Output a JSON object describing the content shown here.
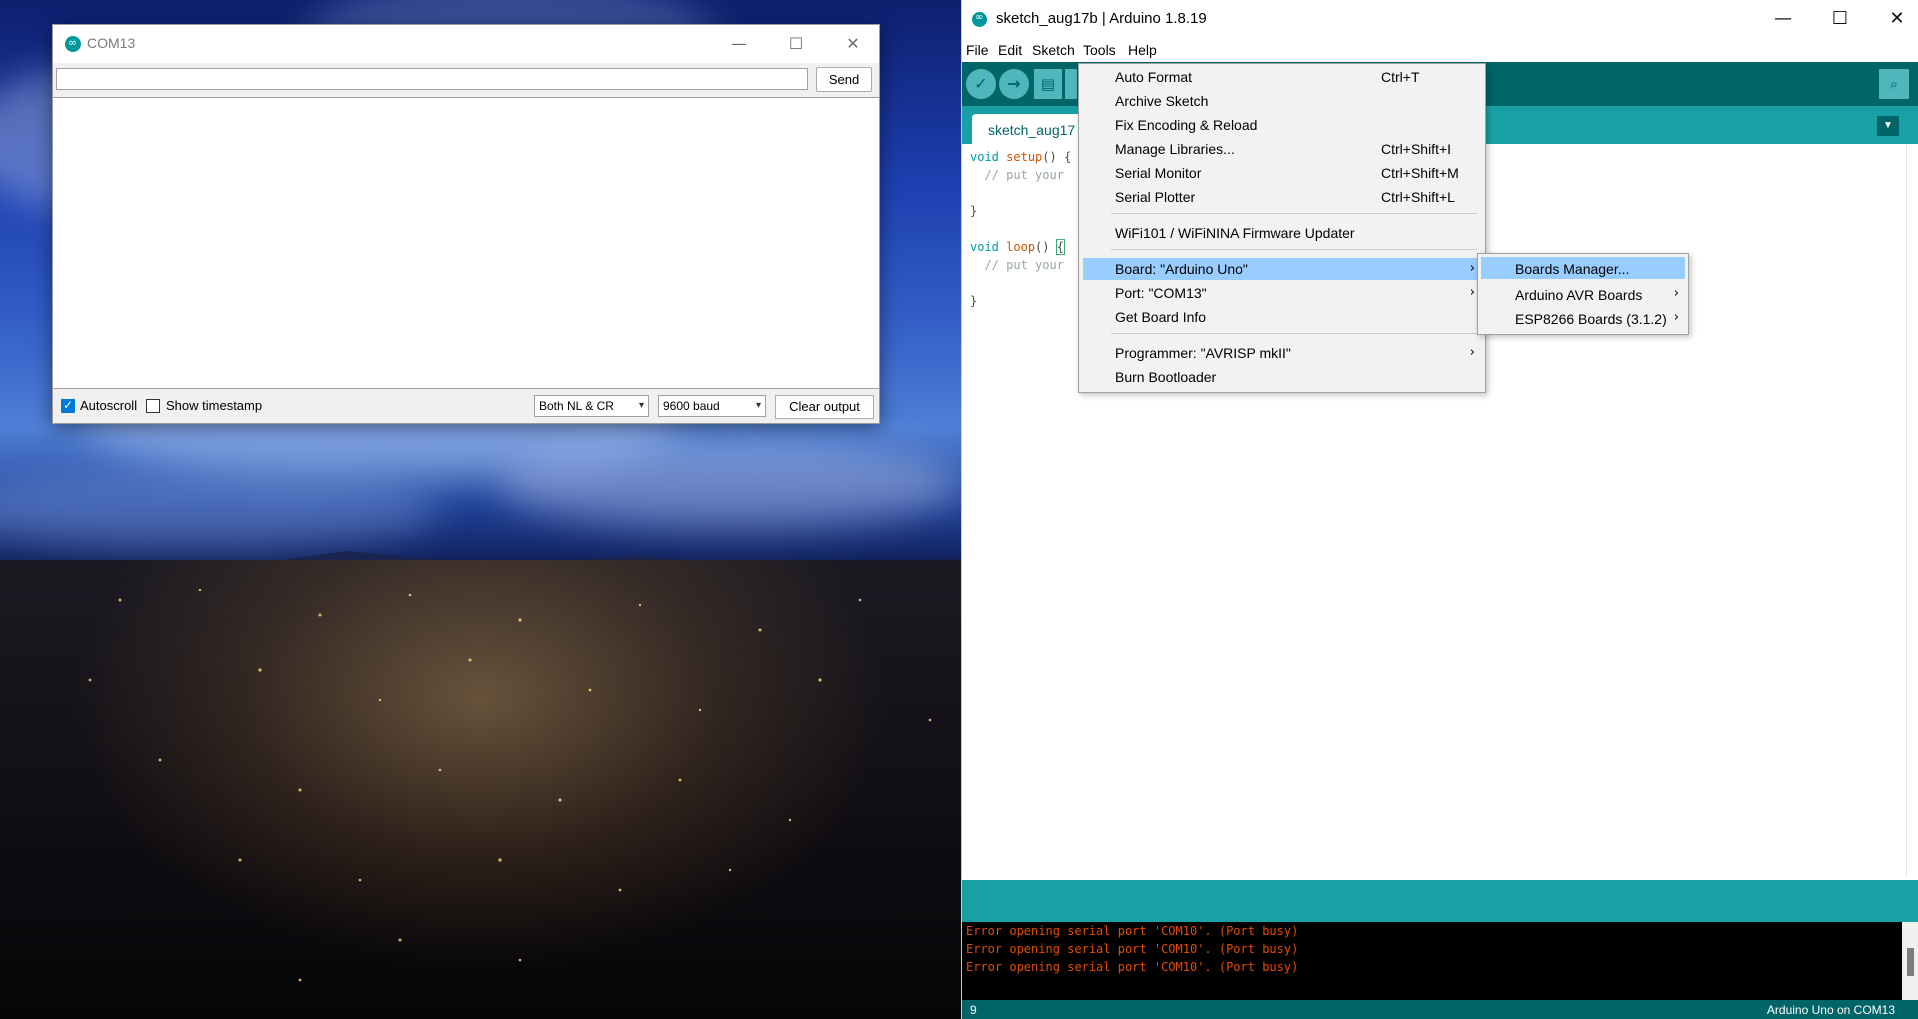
{
  "serial_monitor": {
    "title": "COM13",
    "input_value": "",
    "send_label": "Send",
    "autoscroll_label": "Autoscroll",
    "autoscroll_checked": true,
    "timestamp_label": "Show timestamp",
    "timestamp_checked": false,
    "line_ending": "Both NL & CR",
    "baud_rate": "9600 baud",
    "clear_label": "Clear output",
    "minimize_icon": "minimize-icon",
    "maximize_icon": "maximize-icon",
    "close_icon": "close-icon"
  },
  "ide": {
    "title": "sketch_aug17b | Arduino 1.8.19",
    "menu": [
      "File",
      "Edit",
      "Sketch",
      "Tools",
      "Help"
    ],
    "tab_name": "sketch_aug17",
    "code_lines": [
      "void setup() {",
      "  // put your",
      "",
      "}",
      "",
      "void loop() {",
      "  // put your",
      "",
      "}"
    ],
    "console_lines": [
      "Error opening serial port 'COM10'. (Port busy)",
      "Error opening serial port 'COM10'. (Port busy)",
      "Error opening serial port 'COM10'. (Port busy)"
    ],
    "line_number": "9",
    "board_status": "Arduino Uno on COM13",
    "toolbar_icons": [
      "verify-icon",
      "upload-icon",
      "new-icon",
      "serial-monitor-icon"
    ],
    "accent_color": "#00979c"
  },
  "tools_menu": {
    "items": [
      {
        "label": "Auto Format",
        "shortcut": "Ctrl+T"
      },
      {
        "label": "Archive Sketch",
        "shortcut": ""
      },
      {
        "label": "Fix Encoding & Reload",
        "shortcut": ""
      },
      {
        "label": "Manage Libraries...",
        "shortcut": "Ctrl+Shift+I"
      },
      {
        "label": "Serial Monitor",
        "shortcut": "Ctrl+Shift+M"
      },
      {
        "label": "Serial Plotter",
        "shortcut": "Ctrl+Shift+L"
      },
      {
        "label": "WiFi101 / WiFiNINA Firmware Updater",
        "shortcut": ""
      },
      {
        "label": "Board: \"Arduino Uno\"",
        "shortcut": ""
      },
      {
        "label": "Port: \"COM13\"",
        "shortcut": ""
      },
      {
        "label": "Get Board Info",
        "shortcut": ""
      },
      {
        "label": "Programmer: \"AVRISP mkII\"",
        "shortcut": ""
      },
      {
        "label": "Burn Bootloader",
        "shortcut": ""
      }
    ]
  },
  "board_submenu": {
    "items": [
      {
        "label": "Boards Manager..."
      },
      {
        "label": "Arduino AVR Boards"
      },
      {
        "label": "ESP8266 Boards (3.1.2)"
      }
    ]
  }
}
